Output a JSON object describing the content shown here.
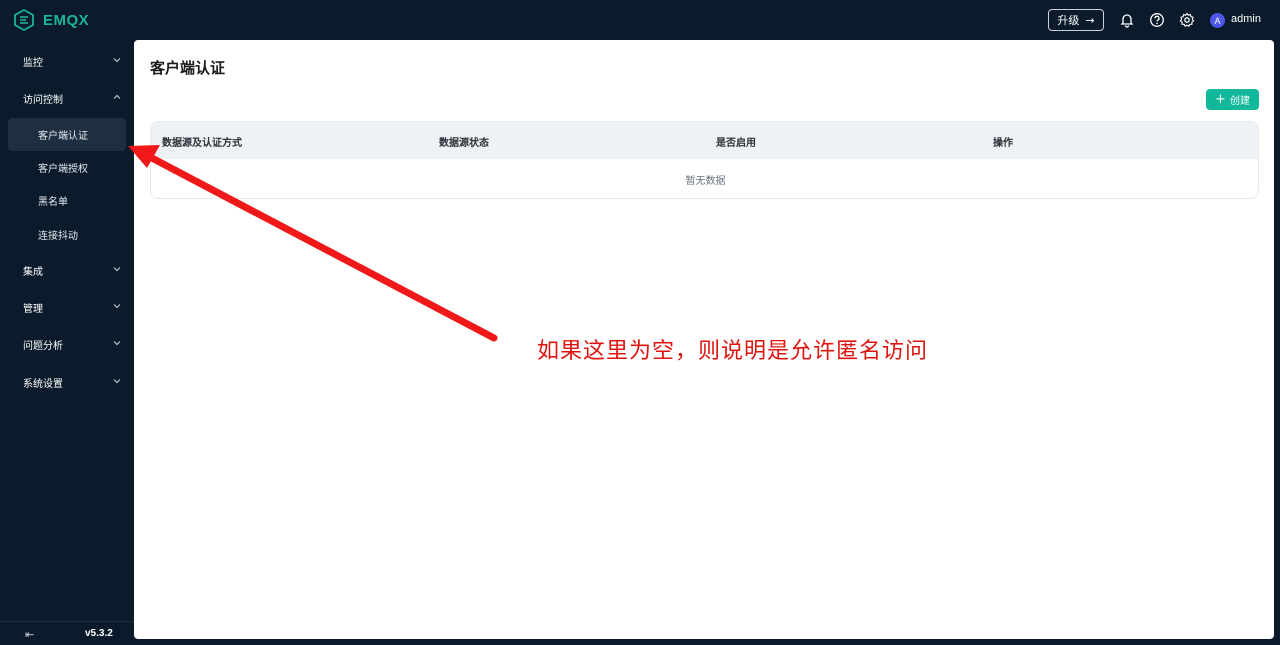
{
  "app": {
    "logo_text": "EMQX",
    "upgrade_label": "升级",
    "username": "admin",
    "avatar_letter": "A",
    "brand_color": "#19b49a"
  },
  "header_icons": [
    "bell-icon",
    "help-icon",
    "gear-icon"
  ],
  "sidebar": {
    "items": [
      {
        "label": "监控",
        "expanded": false
      },
      {
        "label": "访问控制",
        "expanded": true
      },
      {
        "label": "集成",
        "expanded": false
      },
      {
        "label": "管理",
        "expanded": false
      },
      {
        "label": "问题分析",
        "expanded": false
      },
      {
        "label": "系统设置",
        "expanded": false
      }
    ],
    "sub_items": [
      {
        "label": "客户端认证",
        "active": true
      },
      {
        "label": "客户端授权",
        "active": false
      },
      {
        "label": "黑名单",
        "active": false
      },
      {
        "label": "连接抖动",
        "active": false
      }
    ],
    "version": "v5.3.2"
  },
  "main": {
    "title": "客户端认证",
    "create_label": "创建",
    "table": {
      "columns": [
        "数据源及认证方式",
        "数据源状态",
        "是否启用",
        "操作"
      ],
      "empty_text": "暂无数据"
    }
  },
  "annotation": {
    "text": "如果这里为空，则说明是允许匿名访问",
    "color": "#e0140e"
  }
}
